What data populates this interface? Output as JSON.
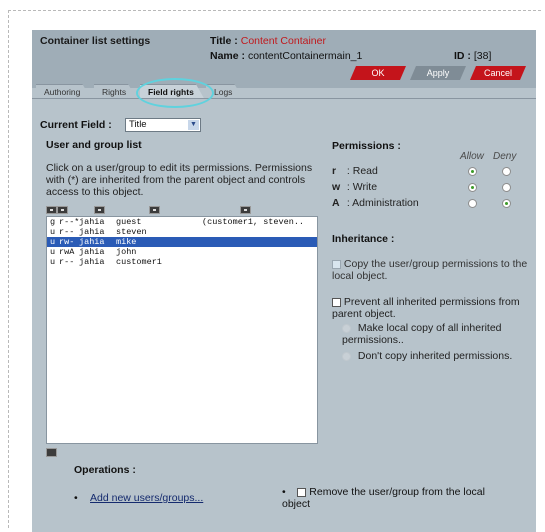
{
  "header": {
    "section": "Container list settings",
    "title_label": "Title :",
    "title_value": "Content Container",
    "name_label": "Name :",
    "name_value": "contentContainermain_1",
    "id_label": "ID :",
    "id_value": "[38]"
  },
  "buttons": {
    "ok": "OK",
    "apply": "Apply",
    "cancel": "Cancel"
  },
  "tabs": [
    {
      "label": "Authoring"
    },
    {
      "label": "Rights"
    },
    {
      "label": "Field rights",
      "active": true
    },
    {
      "label": "Logs"
    }
  ],
  "current_field": {
    "label": "Current Field :",
    "value": "Title"
  },
  "user_group_list": {
    "title": "User and group list",
    "description": "Click on a user/group to edit its permissions. Permissions with (*) are inherited from the parent object and controls access to this object.",
    "rows": [
      {
        "type": "g",
        "perm": "r--*",
        "provider": "jahia",
        "name": "guest",
        "extra": "(customer1, steven.."
      },
      {
        "type": "u",
        "perm": "r--",
        "provider": "jahia",
        "name": "steven",
        "extra": ""
      },
      {
        "type": "u",
        "perm": "rw-",
        "provider": "jahia",
        "name": "mike",
        "extra": "",
        "selected": true
      },
      {
        "type": "u",
        "perm": "rwA",
        "provider": "jahia",
        "name": "john",
        "extra": ""
      },
      {
        "type": "u",
        "perm": "r--",
        "provider": "jahia",
        "name": "customer1",
        "extra": ""
      }
    ]
  },
  "permissions": {
    "title": "Permissions :",
    "allow": "Allow",
    "deny": "Deny",
    "rows": [
      {
        "key": "r",
        "label": ": Read",
        "state": "allow"
      },
      {
        "key": "w",
        "label": ": Write",
        "state": "allow"
      },
      {
        "key": "A",
        "label": ": Administration",
        "state": "deny"
      }
    ]
  },
  "inheritance": {
    "title": "Inheritance :",
    "copy_label": "Copy the user/group permissions to the local object.",
    "prevent_label": "Prevent all inherited permissions from parent object.",
    "make_local": "Make local copy of all inherited permissions..",
    "dont_copy": "Don't copy inherited permissions."
  },
  "operations": {
    "title": "Operations :",
    "add": "Add new users/groups...",
    "remove": "Remove the user/group from the local object"
  },
  "colors": {
    "panel": "#b7c3cb",
    "header": "#9fadb7",
    "ok": "#c4141b",
    "selection": "#2a5bb6"
  }
}
